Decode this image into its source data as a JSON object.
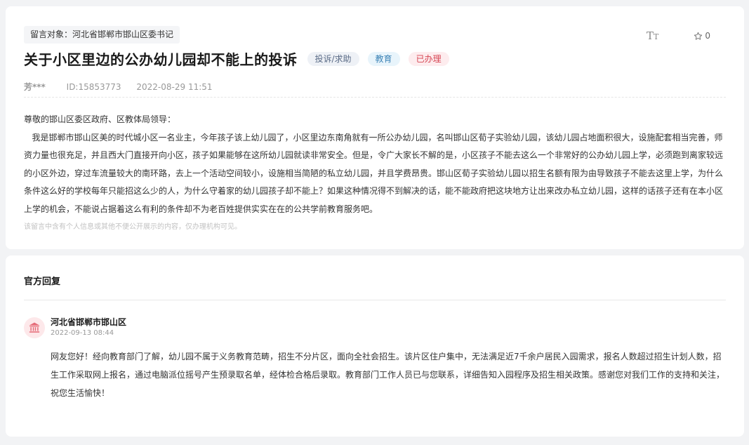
{
  "message": {
    "target_label": "留言对象：河北省邯郸市邯山区委书记",
    "title": "关于小区里边的公办幼儿园却不能上的投诉",
    "tags": [
      {
        "label": "投诉/求助",
        "color": "#5a6b86"
      },
      {
        "label": "教育",
        "color": "#3d83b6"
      },
      {
        "label": "已办理",
        "color": "#d64553"
      }
    ],
    "author": "芳***",
    "id": "ID:15853773",
    "datetime": "2022-08-29 11:51",
    "greeting": "尊敬的邯山区委区政府、区教体局领导：",
    "content": "我是邯郸市邯山区美的时代城小区一名业主，今年孩子该上幼儿园了，小区里边东南角就有一所公办幼儿园，名叫邯山区荀子实验幼儿园，该幼儿园占地面积很大，设施配套相当完善，师资力量也很充足，并且西大门直接开向小区，孩子如果能够在这所幼儿园就读非常安全。但是，令广大家长不解的是，小区孩子不能去这么一个非常好的公办幼儿园上学，必须跑到离家较远的小区外边，穿过车流量较大的南环路，去上一个活动空间较小，设施相当简陋的私立幼儿园，并且学费昂贵。邯山区荀子实验幼儿园以招生名额有限为由导致孩子不能去这里上学，为什么条件这么好的学校每年只能招这么少的人，为什么守着家的幼儿园孩子却不能上？如果这种情况得不到解决的话，能不能政府把这块地方让出来改办私立幼儿园，这样的话孩子还有在本小区上学的机会，不能说占据着这么有利的条件却不为老百姓提供实实在在的公共学前教育服务吧。",
    "privacy_note": "该留言中含有个人信息或其他不便公开展示的内容，仅办理机构可见。"
  },
  "toolbar": {
    "font_size_icon": "font-size-icon",
    "font_size_glyph": "T",
    "font_size_glyph_small": "T",
    "favorite_icon": "star-outline-icon",
    "favorite_count": "0"
  },
  "reply": {
    "section_title": "官方回复",
    "org_icon": "government-building-icon",
    "org_name": "河北省邯郸市邯山区",
    "date": "2022-09-13 08:44",
    "content": "网友您好！经向教育部门了解，幼儿园不属于义务教育范畴，招生不分片区，面向全社会招生。该片区住户集中，无法满足近7千余户居民入园需求，报名人数超过招生计划人数，招生工作采取网上报名，通过电脑派位摇号产生预录取名单，经体检合格后录取。教育部门工作人员已与您联系，详细告知入园程序及招生相关政策。感谢您对我们工作的支持和关注，祝您生活愉快！"
  },
  "colors": {
    "page_bg": "#f2f3f5",
    "accent_red": "#d64553",
    "accent_blue": "#3d83b6"
  }
}
